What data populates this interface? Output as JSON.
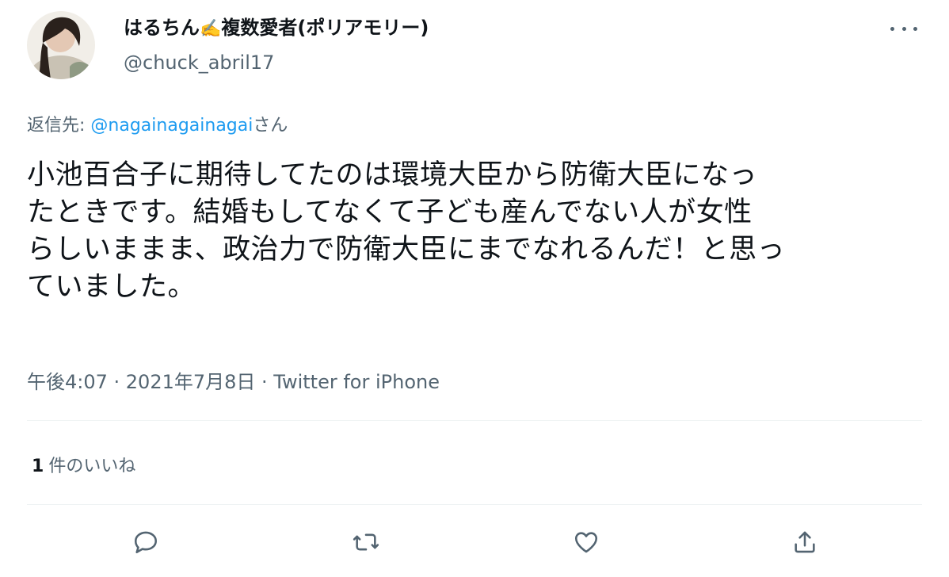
{
  "user": {
    "display_name": "はるちん",
    "name_emoji": "✍️",
    "display_name_suffix": "複数愛者(ポリアモリー)",
    "handle": "@chuck_abril17"
  },
  "reply_to": {
    "prefix": "返信先: ",
    "mention": "@nagainagainagai",
    "suffix": "さん"
  },
  "tweet": {
    "text": "小池百合子に期待してたのは環境大臣から防衛大臣になっ\nたときです。結婚もしてなくて子ども産んでない人が女性\nらしいままま、政治力で防衛大臣にまでなれるんだ！と思っ\nていました。",
    "timestamp": "午後4:07 · 2021年7月8日 · Twitter for iPhone"
  },
  "stats": {
    "likes_count": "1",
    "likes_label": "件のいいね"
  },
  "colors": {
    "text": "#0f1419",
    "secondary": "#536471",
    "link": "#1d9bf0",
    "divider": "#eff3f4"
  },
  "icons": [
    "more-icon",
    "reply-icon",
    "retweet-icon",
    "like-icon",
    "share-icon"
  ]
}
